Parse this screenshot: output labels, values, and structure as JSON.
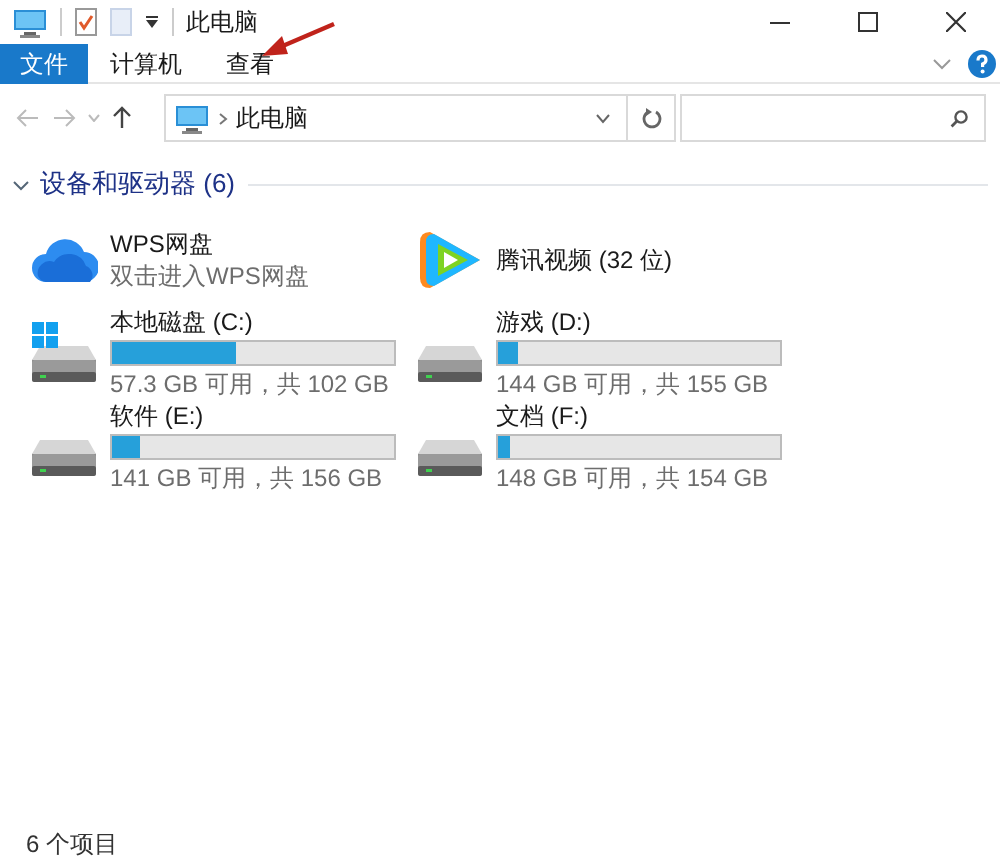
{
  "window": {
    "title": "此电脑"
  },
  "ribbon": {
    "tabs": [
      {
        "label": "文件",
        "kind": "file"
      },
      {
        "label": "计算机",
        "kind": "tab"
      },
      {
        "label": "查看",
        "kind": "tab"
      }
    ]
  },
  "address": {
    "path": "此电脑"
  },
  "group": {
    "title": "设备和驱动器 (6)",
    "expanded": true,
    "items": [
      {
        "kind": "wps",
        "name": "WPS网盘",
        "subtitle": "双击进入WPS网盘"
      },
      {
        "kind": "video",
        "name": "腾讯视频 (32 位)"
      },
      {
        "kind": "system_drive",
        "name": "本地磁盘 (C:)",
        "level": 0.44,
        "space": "57.3 GB 可用，共 102 GB"
      },
      {
        "kind": "drive",
        "name": "游戏 (D:)",
        "level": 0.07,
        "space": "144 GB 可用，共 155 GB"
      },
      {
        "kind": "drive",
        "name": "软件 (E:)",
        "level": 0.1,
        "space": "141 GB 可用，共 156 GB"
      },
      {
        "kind": "drive",
        "name": "文档 (F:)",
        "level": 0.04,
        "space": "148 GB 可用，共 154 GB"
      }
    ]
  },
  "status_bar": {
    "count": "6 个项目"
  }
}
